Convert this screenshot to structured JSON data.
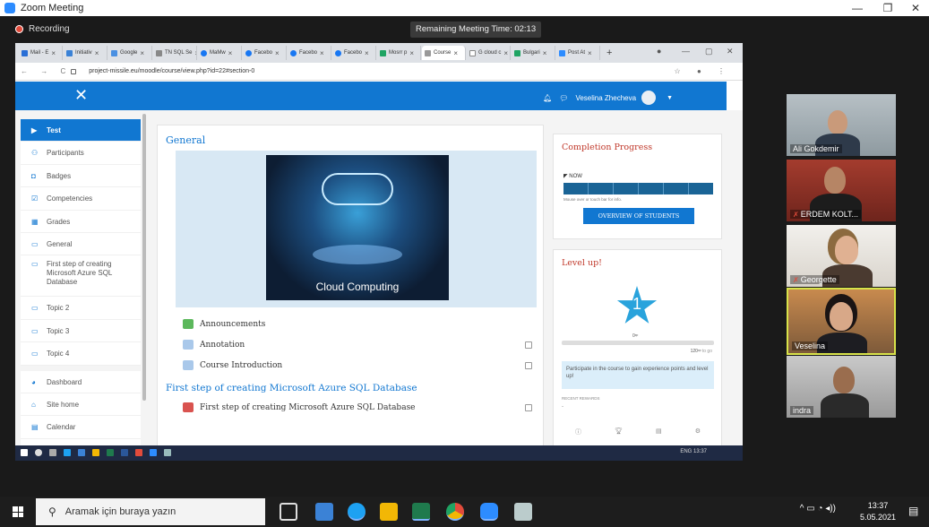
{
  "zoom": {
    "window_title": "Zoom Meeting",
    "recording_label": "Recording",
    "remaining_time": "Remaining Meeting Time: 02:13"
  },
  "browser": {
    "tabs": [
      "Mail - E",
      "Initiativ",
      "Google",
      "TN SQL Se",
      "MaMw",
      "Facebo",
      "Facebo",
      "Facebo",
      "Mosrr p",
      "Course",
      "G cloud c",
      "Bulgari",
      "Post At"
    ],
    "address": "project-missile.eu/moodle/course/view.php?id=22#section-0"
  },
  "moodle": {
    "user_name": "Veselina Zhecheva",
    "sidebar": [
      {
        "label": "Test",
        "icon": "graduation-cap-icon",
        "glyph": "▶"
      },
      {
        "label": "Participants",
        "icon": "users-icon",
        "glyph": "⚇"
      },
      {
        "label": "Badges",
        "icon": "shield-icon",
        "glyph": "◘"
      },
      {
        "label": "Competencies",
        "icon": "check-square-icon",
        "glyph": "☑"
      },
      {
        "label": "Grades",
        "icon": "table-icon",
        "glyph": "▦"
      },
      {
        "label": "General",
        "icon": "folder-icon",
        "glyph": "▭"
      },
      {
        "label": "First step of creating Microsoft Azure SQL Database",
        "icon": "folder-icon",
        "glyph": "▭"
      },
      {
        "label": "Topic 2",
        "icon": "folder-icon",
        "glyph": "▭"
      },
      {
        "label": "Topic 3",
        "icon": "folder-icon",
        "glyph": "▭"
      },
      {
        "label": "Topic 4",
        "icon": "folder-icon",
        "glyph": "▭"
      },
      {
        "label": "Dashboard",
        "icon": "dashboard-icon",
        "glyph": "◕"
      },
      {
        "label": "Site home",
        "icon": "home-icon",
        "glyph": "⌂"
      },
      {
        "label": "Calendar",
        "icon": "calendar-icon",
        "glyph": "▤"
      }
    ],
    "section_general": "General",
    "banner_caption": "Cloud Computing",
    "activities": [
      "Announcements",
      "Annotation",
      "Course Introduction"
    ],
    "section_2": "First step of creating Microsoft Azure SQL Database",
    "section_2_activity": "First step of creating Microsoft Azure SQL Database",
    "completion": {
      "title": "Completion Progress",
      "now_label": "NOW",
      "hint": "Mouse over or touch bar for info.",
      "button": "OVERVIEW OF STUDENTS"
    },
    "levelup": {
      "title": "Level up!",
      "level": "1",
      "xp_current": "0ˣᵖ",
      "xp_to_go": "120ˣᵖ",
      "xp_to_go_suffix": "to go",
      "message": "Participate in the course to gain experience points and level up!",
      "recent_label": "RECENT REWARDS",
      "recent_value": "-"
    }
  },
  "participants": [
    {
      "name": "Ali Gokdemir",
      "muted": false
    },
    {
      "name": "ERDEM KOLT...",
      "muted": true
    },
    {
      "name": "Georgette",
      "muted": true
    },
    {
      "name": "Veselina",
      "muted": false
    },
    {
      "name": "indra",
      "muted": false
    }
  ],
  "remote_taskbar": {
    "clock": "ENG 13:37"
  },
  "taskbar": {
    "search_placeholder": "Aramak için buraya yazın",
    "time": "13:37",
    "date": "5.05.2021",
    "notifications": "2"
  }
}
